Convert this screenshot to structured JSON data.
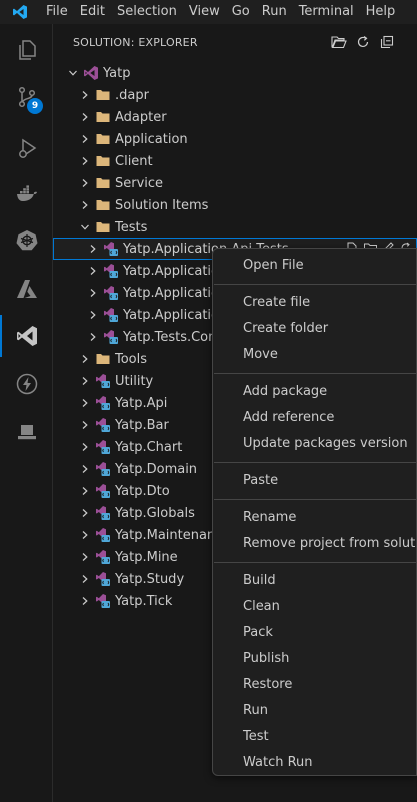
{
  "colors": {
    "accent": "#0078d4",
    "folder": "#dcb67a",
    "vs_purple": "#9b4f96",
    "vscode_blue": "#23a9f2"
  },
  "menubar": {
    "items": [
      "File",
      "Edit",
      "Selection",
      "View",
      "Go",
      "Run",
      "Terminal",
      "Help"
    ]
  },
  "activitybar": {
    "items": [
      {
        "name": "explorer-icon"
      },
      {
        "name": "source-control-icon",
        "badge": "9"
      },
      {
        "name": "run-debug-icon"
      },
      {
        "name": "docker-icon"
      },
      {
        "name": "kubernetes-icon"
      },
      {
        "name": "azure-icon"
      },
      {
        "name": "solution-explorer-icon",
        "active": true
      },
      {
        "name": "thunder-client-icon"
      },
      {
        "name": "remote-explorer-icon"
      }
    ]
  },
  "sidebar": {
    "title": "SOLUTION: EXPLORER",
    "actions": [
      "open-folder-icon",
      "refresh-icon",
      "collapse-all-icon"
    ]
  },
  "tree": [
    {
      "label": "Yatp",
      "depth": 0,
      "kind": "solution",
      "expanded": true
    },
    {
      "label": ".dapr",
      "depth": 1,
      "kind": "folder"
    },
    {
      "label": "Adapter",
      "depth": 1,
      "kind": "folder"
    },
    {
      "label": "Application",
      "depth": 1,
      "kind": "folder"
    },
    {
      "label": "Client",
      "depth": 1,
      "kind": "folder"
    },
    {
      "label": "Service",
      "depth": 1,
      "kind": "folder"
    },
    {
      "label": "Solution Items",
      "depth": 1,
      "kind": "folder"
    },
    {
      "label": "Tests",
      "depth": 1,
      "kind": "folder",
      "expanded": true
    },
    {
      "label": "Yatp.Application.Api.Tests",
      "depth": 2,
      "kind": "project",
      "selected": true
    },
    {
      "label": "Yatp.Application",
      "depth": 2,
      "kind": "project"
    },
    {
      "label": "Yatp.Application",
      "depth": 2,
      "kind": "project"
    },
    {
      "label": "Yatp.Application",
      "depth": 2,
      "kind": "project"
    },
    {
      "label": "Yatp.Tests.Comm",
      "depth": 2,
      "kind": "project"
    },
    {
      "label": "Tools",
      "depth": 1,
      "kind": "folder"
    },
    {
      "label": "Utility",
      "depth": 1,
      "kind": "project"
    },
    {
      "label": "Yatp.Api",
      "depth": 1,
      "kind": "project"
    },
    {
      "label": "Yatp.Bar",
      "depth": 1,
      "kind": "project"
    },
    {
      "label": "Yatp.Chart",
      "depth": 1,
      "kind": "project"
    },
    {
      "label": "Yatp.Domain",
      "depth": 1,
      "kind": "project"
    },
    {
      "label": "Yatp.Dto",
      "depth": 1,
      "kind": "project"
    },
    {
      "label": "Yatp.Globals",
      "depth": 1,
      "kind": "project"
    },
    {
      "label": "Yatp.Maintenance",
      "depth": 1,
      "kind": "project"
    },
    {
      "label": "Yatp.Mine",
      "depth": 1,
      "kind": "project"
    },
    {
      "label": "Yatp.Study",
      "depth": 1,
      "kind": "project"
    },
    {
      "label": "Yatp.Tick",
      "depth": 1,
      "kind": "project"
    }
  ],
  "context_menu": {
    "groups": [
      [
        "Open File"
      ],
      [
        "Create file",
        "Create folder",
        "Move"
      ],
      [
        "Add package",
        "Add reference",
        "Update packages version"
      ],
      [
        "Paste"
      ],
      [
        "Rename",
        "Remove project from solution"
      ],
      [
        "Build",
        "Clean",
        "Pack",
        "Publish",
        "Restore",
        "Run",
        "Test",
        "Watch Run"
      ]
    ]
  }
}
